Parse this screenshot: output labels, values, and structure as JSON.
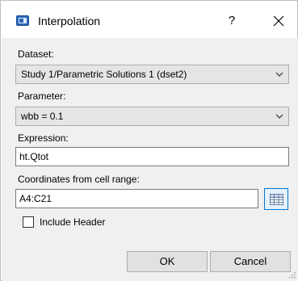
{
  "window": {
    "title": "Interpolation",
    "help_label": "?",
    "icon": "app-icon",
    "close_icon": "close-icon"
  },
  "dataset": {
    "label": "Dataset:",
    "selected": "Study 1/Parametric Solutions 1 (dset2)"
  },
  "parameter": {
    "label": "Parameter:",
    "selected": "wbb = 0.1"
  },
  "expression": {
    "label": "Expression:",
    "value": "ht.Qtot"
  },
  "coordinates": {
    "label": "Coordinates from cell range:",
    "value": "A4:C21",
    "button_icon": "table-range-icon"
  },
  "include_header": {
    "label": "Include Header",
    "checked": false
  },
  "buttons": {
    "ok": "OK",
    "cancel": "Cancel"
  },
  "colors": {
    "accent": "#0078d7",
    "body_bg": "#f0f0f0",
    "combo_bg": "#e5e5e5"
  }
}
